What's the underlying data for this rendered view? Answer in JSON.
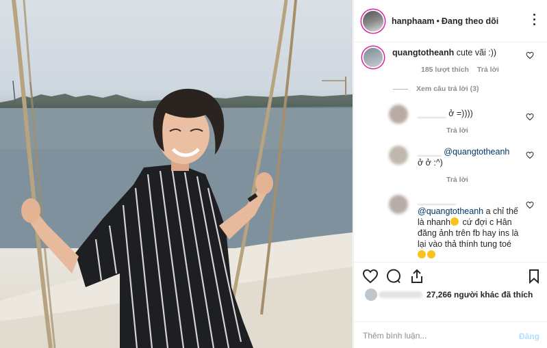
{
  "post": {
    "author": "hanphaam",
    "separator": "•",
    "follow_status": "Đang theo dõi"
  },
  "comments": [
    {
      "username": "quangtotheanh",
      "text": "cute vãi :))",
      "likes": "185 lượt thích",
      "reply_label": "Trả lời",
      "view_replies": "Xem câu trả lời (3)"
    },
    {
      "username_blurred": "______",
      "text": "ở =))))",
      "reply_label": "Trả lời"
    },
    {
      "username_blurred": "_____",
      "mention": "@quangtotheanh",
      "text": "ở ở :^)",
      "reply_label": "Trả lời"
    },
    {
      "username_blurred": "________",
      "mention": "@quangtotheanh",
      "text_line1": "a chỉ thế",
      "text_line2a": "là nhanh",
      "text_line2b": "cứ đợi c Hân",
      "text_line3": "đăng ảnh trên fb hay ins là",
      "text_line4": "lại vào thả thính tung toé"
    }
  ],
  "actions": {
    "like_icon": "heart-icon",
    "comment_icon": "comment-icon",
    "share_icon": "share-icon",
    "save_icon": "bookmark-icon"
  },
  "likes_summary": {
    "count": "27,266",
    "suffix": "người khác đã thích"
  },
  "comment_box": {
    "placeholder": "Thêm bình luận...",
    "post_label": "Đăng"
  },
  "colors": {
    "accent_blue": "#003569",
    "muted_text": "#8e8e8e",
    "post_button_disabled": "#b2dffc",
    "story_ring": "#d6249f"
  }
}
